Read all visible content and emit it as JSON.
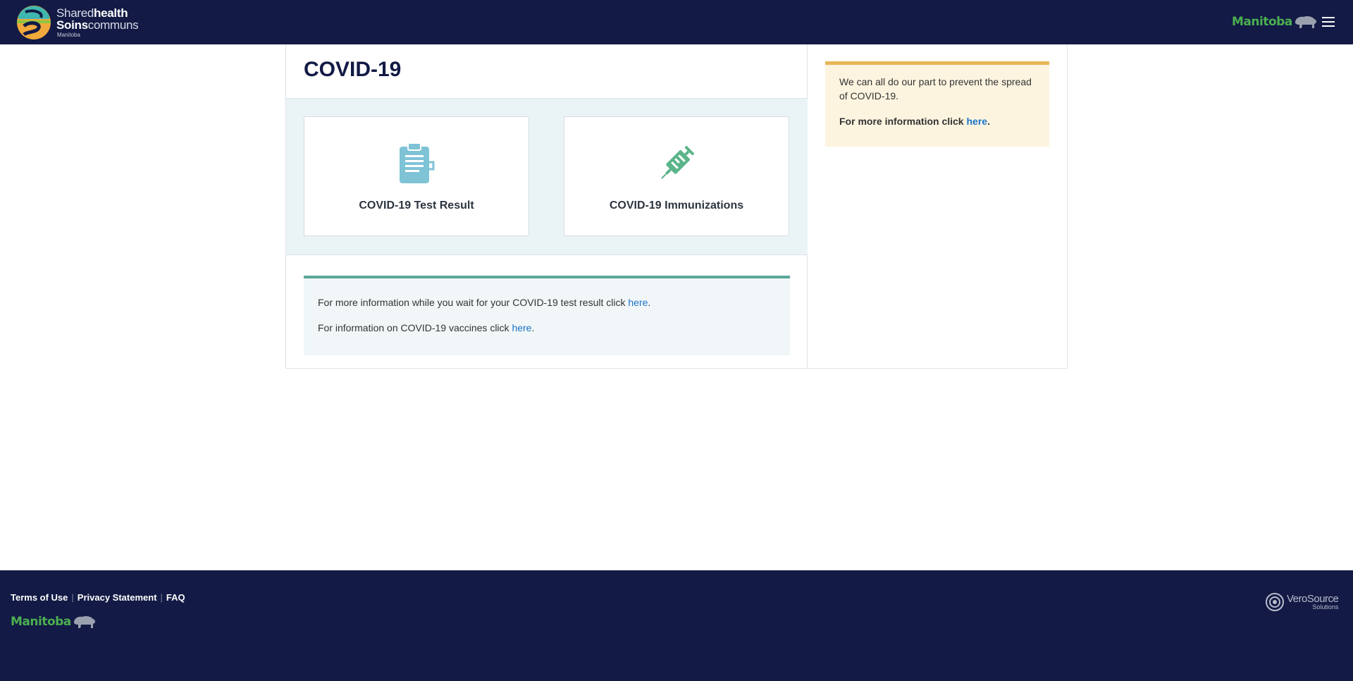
{
  "header": {
    "logo": {
      "line1_light": "Shared",
      "line1_bold": "health",
      "line2_bold": "Soins",
      "line2_light": "communs",
      "line3": "Manitoba"
    },
    "province_wordmark": "Manitoba",
    "menu_icon": "hamburger-menu-icon"
  },
  "main": {
    "title": "COVID-19",
    "tiles": [
      {
        "label": "COVID-19 Test Result",
        "icon": "clipboard-icon",
        "color": "#7ec3d6"
      },
      {
        "label": "COVID-19 Immunizations",
        "icon": "syringe-icon",
        "color": "#5bb48a"
      }
    ],
    "info": {
      "line1_text": "For more information while you wait for your COVID-19 test result click ",
      "line1_link": "here",
      "line1_end": ".",
      "line2_text": "For information on COVID-19 vaccines click ",
      "line2_link": "here",
      "line2_end": "."
    }
  },
  "sidebar": {
    "notice_text": "We can all do our part to prevent the spread of COVID-19.",
    "more_text": "For more information click ",
    "more_link": "here",
    "more_end": "."
  },
  "footer": {
    "links": [
      "Terms of Use",
      "Privacy Statement",
      "FAQ"
    ],
    "province_wordmark": "Manitoba",
    "vendor_line1": "VeroSource",
    "vendor_line2": "Solutions"
  },
  "colors": {
    "navy": "#121a45",
    "link": "#1a73c8",
    "teal_border": "#5aa89c",
    "notice_border": "#e6b655",
    "manitoba_green": "#4caf50"
  }
}
